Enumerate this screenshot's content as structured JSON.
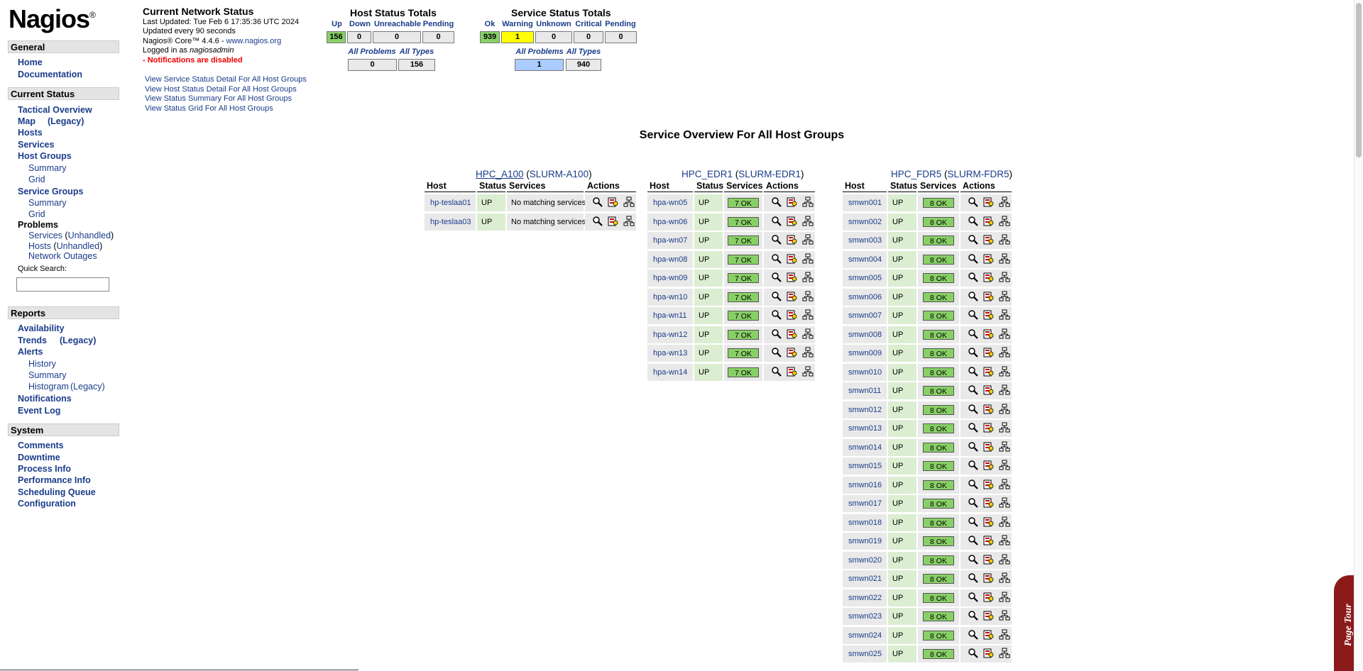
{
  "sidebar": {
    "logo": "Nagios",
    "logo_mark": "®",
    "general_header": "General",
    "home": "Home",
    "documentation": "Documentation",
    "current_status_header": "Current Status",
    "tactical_overview": "Tactical Overview",
    "map": "Map",
    "map_legacy": "(Legacy)",
    "hosts": "Hosts",
    "services": "Services",
    "host_groups": "Host Groups",
    "hg_summary": "Summary",
    "hg_grid": "Grid",
    "service_groups": "Service Groups",
    "sg_summary": "Summary",
    "sg_grid": "Grid",
    "problems": "Problems",
    "prob_services": "Services",
    "prob_services_unhandled": "Unhandled",
    "prob_hosts": "Hosts",
    "prob_hosts_unhandled": "Unhandled",
    "network_outages": "Network Outages",
    "quick_search_label": "Quick Search:",
    "reports_header": "Reports",
    "availability": "Availability",
    "trends": "Trends",
    "trends_legacy": "(Legacy)",
    "alerts": "Alerts",
    "alerts_history": "History",
    "alerts_summary": "Summary",
    "alerts_histogram": "Histogram",
    "alerts_histogram_legacy": "(Legacy)",
    "notifications": "Notifications",
    "event_log": "Event Log",
    "system_header": "System",
    "comments": "Comments",
    "downtime": "Downtime",
    "process_info": "Process Info",
    "performance_info": "Performance Info",
    "scheduling_queue": "Scheduling Queue",
    "configuration": "Configuration"
  },
  "status_info": {
    "title": "Current Network Status",
    "last_updated": "Last Updated: Tue Feb 6 17:35:36 UTC 2024",
    "update_interval": "Updated every 90 seconds",
    "version_prefix": "Nagios® Core™ 4.4.6 - ",
    "version_link": "www.nagios.org",
    "logged_in_prefix": "Logged in as ",
    "user": "nagiosadmin",
    "notifications_warning": "- Notifications are disabled"
  },
  "view_links": [
    "View Service Status Detail For All Host Groups",
    "View Host Status Detail For All Host Groups",
    "View Status Summary For All Host Groups",
    "View Status Grid For All Host Groups"
  ],
  "host_totals": {
    "title": "Host Status Totals",
    "labels": [
      "Up",
      "Down",
      "Unreachable",
      "Pending"
    ],
    "values": [
      "156",
      "0",
      "0",
      "0"
    ],
    "summary_labels": [
      "All Problems",
      "All Types"
    ],
    "summary_values": [
      "0",
      "156"
    ]
  },
  "service_totals": {
    "title": "Service Status Totals",
    "labels": [
      "Ok",
      "Warning",
      "Unknown",
      "Critical",
      "Pending"
    ],
    "values": [
      "939",
      "1",
      "0",
      "0",
      "0"
    ],
    "summary_labels": [
      "All Problems",
      "All Types"
    ],
    "summary_values": [
      "1",
      "940"
    ]
  },
  "page_heading": "Service Overview For All Host Groups",
  "table_headers": [
    "Host",
    "Status",
    "Services",
    "Actions"
  ],
  "host_groups": [
    {
      "name": "HPC_A100",
      "alias": "SLURM-A100",
      "hosts": [
        {
          "host": "hp-teslaa01",
          "status": "UP",
          "services": "No matching services"
        },
        {
          "host": "hp-teslaa03",
          "status": "UP",
          "services": "No matching services"
        }
      ]
    },
    {
      "name": "HPC_EDR1",
      "alias": "SLURM-EDR1",
      "hosts": [
        {
          "host": "hpa-wn05",
          "status": "UP",
          "services": "7 OK"
        },
        {
          "host": "hpa-wn06",
          "status": "UP",
          "services": "7 OK"
        },
        {
          "host": "hpa-wn07",
          "status": "UP",
          "services": "7 OK"
        },
        {
          "host": "hpa-wn08",
          "status": "UP",
          "services": "7 OK"
        },
        {
          "host": "hpa-wn09",
          "status": "UP",
          "services": "7 OK"
        },
        {
          "host": "hpa-wn10",
          "status": "UP",
          "services": "7 OK"
        },
        {
          "host": "hpa-wn11",
          "status": "UP",
          "services": "7 OK"
        },
        {
          "host": "hpa-wn12",
          "status": "UP",
          "services": "7 OK"
        },
        {
          "host": "hpa-wn13",
          "status": "UP",
          "services": "7 OK"
        },
        {
          "host": "hpa-wn14",
          "status": "UP",
          "services": "7 OK"
        }
      ]
    },
    {
      "name": "HPC_FDR5",
      "alias": "SLURM-FDR5",
      "hosts": [
        {
          "host": "smwn001",
          "status": "UP",
          "services": "8 OK"
        },
        {
          "host": "smwn002",
          "status": "UP",
          "services": "8 OK"
        },
        {
          "host": "smwn003",
          "status": "UP",
          "services": "8 OK"
        },
        {
          "host": "smwn004",
          "status": "UP",
          "services": "8 OK"
        },
        {
          "host": "smwn005",
          "status": "UP",
          "services": "8 OK"
        },
        {
          "host": "smwn006",
          "status": "UP",
          "services": "8 OK"
        },
        {
          "host": "smwn007",
          "status": "UP",
          "services": "8 OK"
        },
        {
          "host": "smwn008",
          "status": "UP",
          "services": "8 OK"
        },
        {
          "host": "smwn009",
          "status": "UP",
          "services": "8 OK"
        },
        {
          "host": "smwn010",
          "status": "UP",
          "services": "8 OK"
        },
        {
          "host": "smwn011",
          "status": "UP",
          "services": "8 OK"
        },
        {
          "host": "smwn012",
          "status": "UP",
          "services": "8 OK"
        },
        {
          "host": "smwn013",
          "status": "UP",
          "services": "8 OK"
        },
        {
          "host": "smwn014",
          "status": "UP",
          "services": "8 OK"
        },
        {
          "host": "smwn015",
          "status": "UP",
          "services": "8 OK"
        },
        {
          "host": "smwn016",
          "status": "UP",
          "services": "8 OK"
        },
        {
          "host": "smwn017",
          "status": "UP",
          "services": "8 OK"
        },
        {
          "host": "smwn018",
          "status": "UP",
          "services": "8 OK"
        },
        {
          "host": "smwn019",
          "status": "UP",
          "services": "8 OK"
        },
        {
          "host": "smwn020",
          "status": "UP",
          "services": "8 OK"
        },
        {
          "host": "smwn021",
          "status": "UP",
          "services": "8 OK"
        },
        {
          "host": "smwn022",
          "status": "UP",
          "services": "8 OK"
        },
        {
          "host": "smwn023",
          "status": "UP",
          "services": "8 OK"
        },
        {
          "host": "smwn024",
          "status": "UP",
          "services": "8 OK"
        },
        {
          "host": "smwn025",
          "status": "UP",
          "services": "8 OK"
        }
      ]
    }
  ],
  "page_tour": "Page Tour",
  "icons": {
    "details": "magnifier-icon",
    "services": "service-detail-icon",
    "map": "status-map-icon"
  },
  "colors": {
    "ok": "#88d066",
    "warning": "#ffff00",
    "problem_highlight": "#aaccff",
    "link": "#1a3c8a",
    "alert": "#e00000"
  }
}
